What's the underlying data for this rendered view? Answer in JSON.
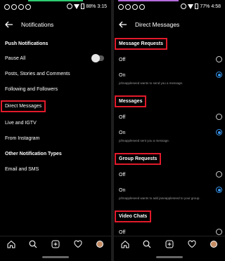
{
  "left": {
    "status_time": "3:15",
    "battery": "88%",
    "title": "Notifications",
    "sections": [
      {
        "kind": "head",
        "label": "Push Notifications"
      },
      {
        "kind": "toggle",
        "label": "Pause All"
      },
      {
        "kind": "item",
        "label": "Posts, Stories and Comments"
      },
      {
        "kind": "item",
        "label": "Following and Followers"
      },
      {
        "kind": "highlight",
        "label": "Direct Messages"
      },
      {
        "kind": "item",
        "label": "Live and IGTV"
      },
      {
        "kind": "item",
        "label": "From Instagram"
      },
      {
        "kind": "head",
        "label": "Other Notification Types"
      },
      {
        "kind": "item",
        "label": "Email and SMS"
      }
    ]
  },
  "right": {
    "status_time": "4:58",
    "battery": "77%",
    "title": "Direct Messages",
    "groups": [
      {
        "header": "Message Requests",
        "off": "Off",
        "on": "On",
        "caption": "johnappleseed wants to send you a message."
      },
      {
        "header": "Messages",
        "off": "Off",
        "on": "On",
        "caption": "johnappleseed sent you a message."
      },
      {
        "header": "Group Requests",
        "off": "Off",
        "on": "On",
        "caption": "johnappleseed wants to add janeappleseed to your group."
      },
      {
        "header": "Video Chats",
        "off": "Off"
      }
    ]
  },
  "icons": {
    "back": "arrow-left-icon",
    "tabs": [
      "home-icon",
      "search-icon",
      "add-post-icon",
      "heart-icon",
      "profile-avatar-icon"
    ]
  },
  "colors": {
    "highlight_border": "#e11a2b",
    "radio_selected": "#3897f0",
    "background": "#000000"
  }
}
